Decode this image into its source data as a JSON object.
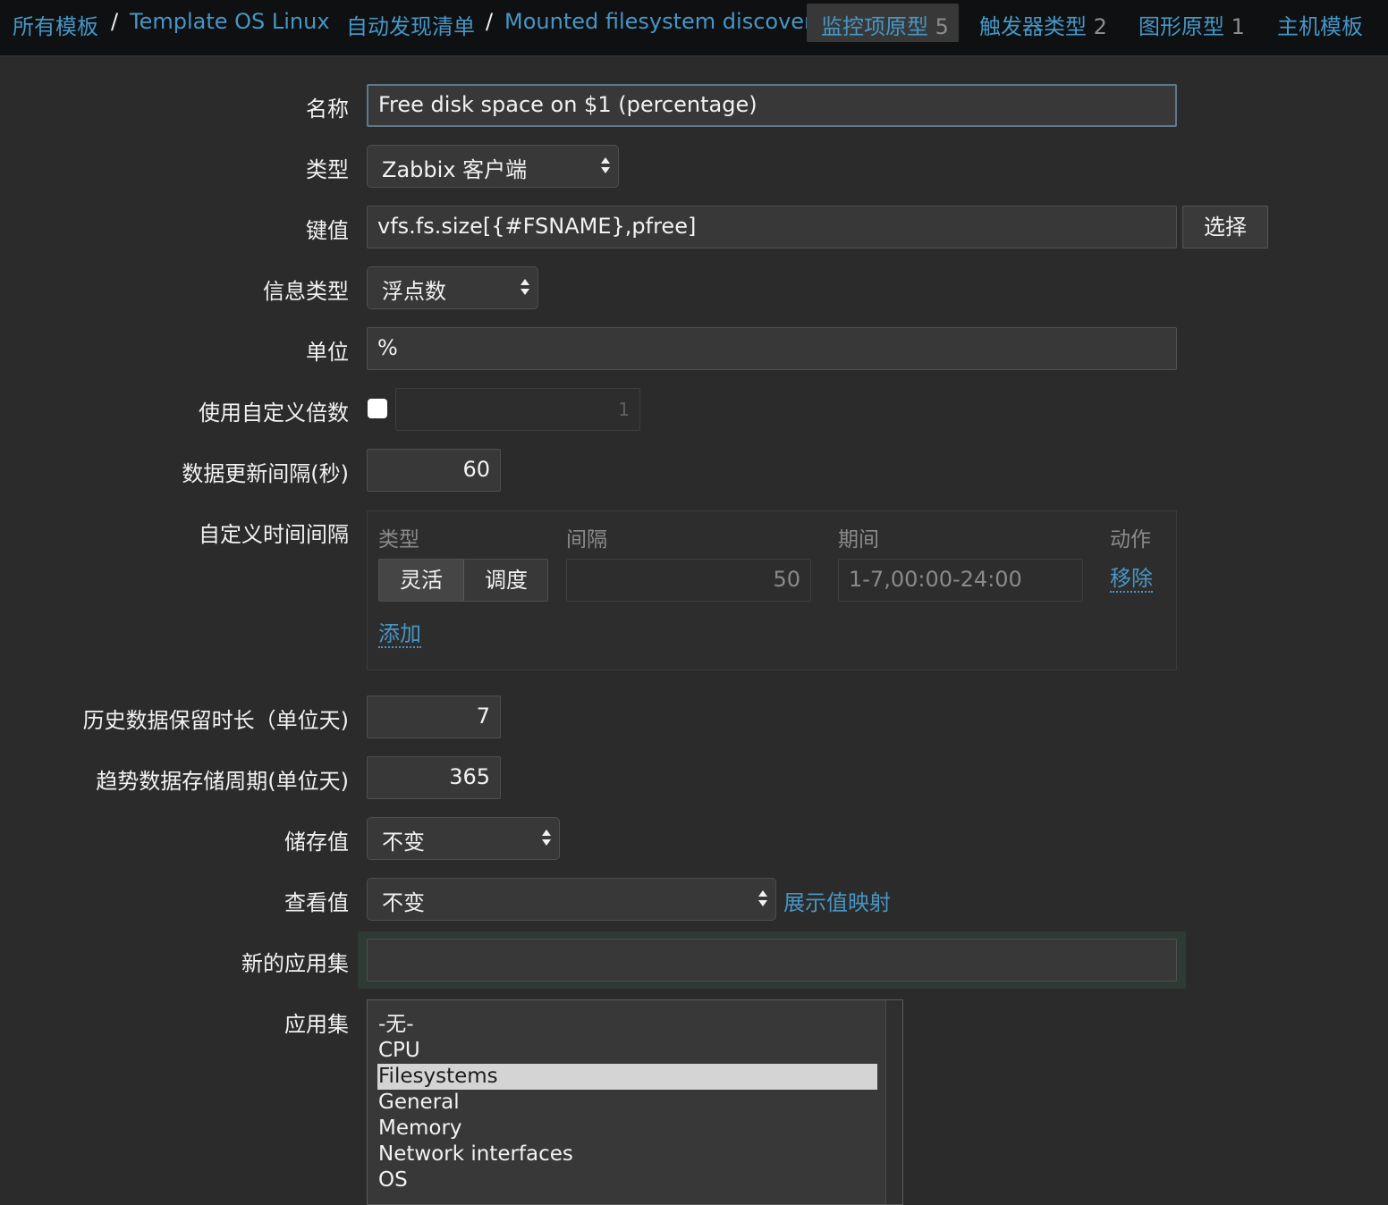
{
  "breadcrumb": {
    "all_templates": "所有模板",
    "sep1": "/",
    "template_name": "Template OS Linux",
    "discovery_list": "自动发现清单",
    "sep2": "/",
    "discovery_rule": "Mounted filesystem discovery"
  },
  "tabs": [
    {
      "label": "监控项原型",
      "count": "5"
    },
    {
      "label": "触发器类型",
      "count": "2"
    },
    {
      "label": "图形原型",
      "count": "1"
    },
    {
      "label": "主机模板",
      "count": ""
    }
  ],
  "form": {
    "name": {
      "label": "名称",
      "value": "Free disk space on $1 (percentage)"
    },
    "type": {
      "label": "类型",
      "value": "Zabbix 客户端"
    },
    "key": {
      "label": "键值",
      "value": "vfs.fs.size[{#FSNAME},pfree]",
      "select_button": "选择"
    },
    "info_type": {
      "label": "信息类型",
      "value": "浮点数"
    },
    "units": {
      "label": "单位",
      "value": "%"
    },
    "multiplier": {
      "label": "使用自定义倍数",
      "checked": false,
      "value": "1"
    },
    "update_interval": {
      "label": "数据更新间隔(秒)",
      "value": "60"
    },
    "custom_intervals": {
      "label": "自定义时间间隔",
      "headers": {
        "type": "类型",
        "interval": "间隔",
        "period": "期间",
        "action": "动作"
      },
      "row": {
        "flexible": "灵活",
        "scheduling": "调度",
        "interval": "50",
        "period": "1-7,00:00-24:00",
        "remove": "移除"
      },
      "add": "添加"
    },
    "history": {
      "label": "历史数据保留时长（单位天)",
      "value": "7"
    },
    "trends": {
      "label": "趋势数据存储周期(单位天)",
      "value": "365"
    },
    "store_value": {
      "label": "储存值",
      "value": "不变"
    },
    "show_value": {
      "label": "查看值",
      "value": "不变",
      "mapping_link": "展示值映射"
    },
    "new_application": {
      "label": "新的应用集",
      "value": ""
    },
    "applications": {
      "label": "应用集",
      "options": [
        "-无-",
        "CPU",
        "Filesystems",
        "General",
        "Memory",
        "Network interfaces",
        "OS"
      ],
      "selected": "Filesystems"
    }
  },
  "colors": {
    "link": "#4796c4",
    "background": "#2b2b2b",
    "topbar": "#0e1012",
    "input": "#383838",
    "selected_option": "#d4d4d4"
  }
}
